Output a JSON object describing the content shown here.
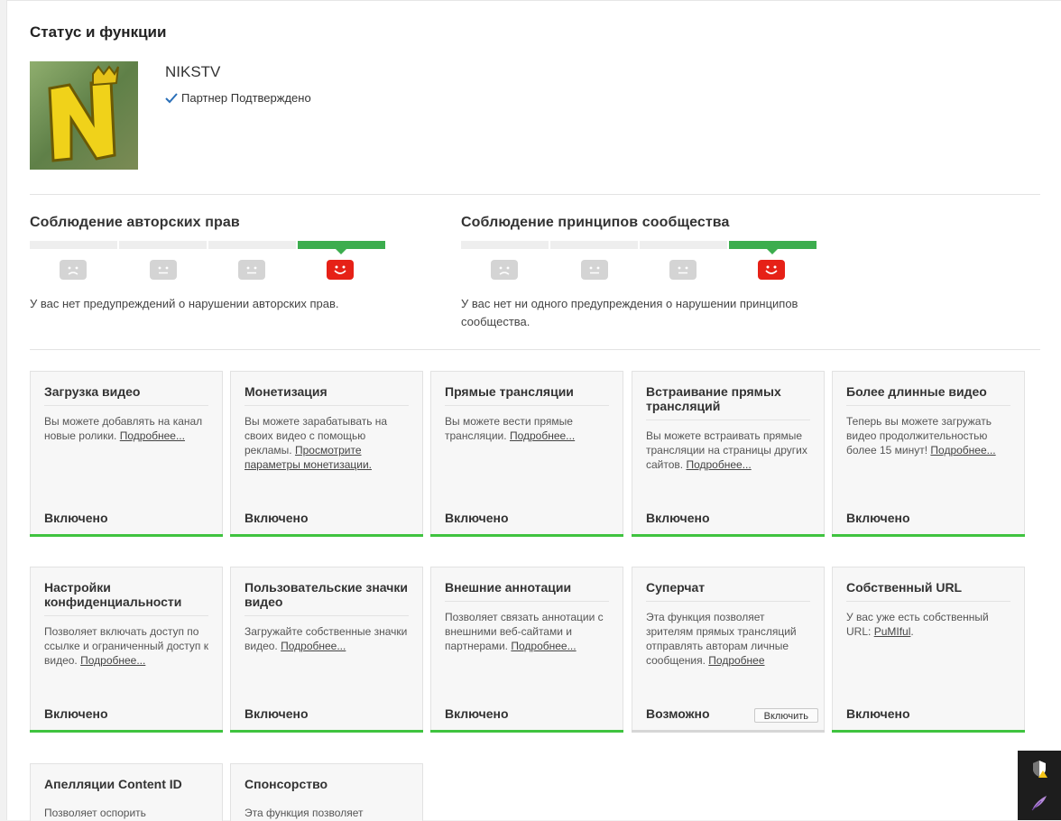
{
  "page": {
    "title": "Статус и функции"
  },
  "channel": {
    "name": "NIKSTV",
    "status": "Партнер Подтверждено"
  },
  "copyright": {
    "title": "Соблюдение авторских прав",
    "message": "У вас нет предупреждений о нарушении авторских прав."
  },
  "community": {
    "title": "Соблюдение принципов сообщества",
    "message": "У вас нет ни одного предупреждения о нарушении принципов сообщества."
  },
  "cards": [
    {
      "title": "Загрузка видео",
      "desc": "Вы можете добавлять на канал новые ролики.",
      "link": "Подробнее...",
      "status": "Включено"
    },
    {
      "title": "Монетизация",
      "desc": "Вы можете зарабатывать на своих видео с помощью рекламы.",
      "link": "Просмотрите параметры монетизации.",
      "status": "Включено"
    },
    {
      "title": "Прямые трансляции",
      "desc": "Вы можете вести прямые трансляции.",
      "link": "Подробнее...",
      "status": "Включено"
    },
    {
      "title": "Встраивание прямых трансляций",
      "desc": "Вы можете встраивать прямые трансляции на страницы других сайтов.",
      "link": "Подробнее...",
      "status": "Включено"
    },
    {
      "title": "Более длинные видео",
      "desc": "Теперь вы можете загружать видео продолжительностью более 15 минут!",
      "link": "Подробнее...",
      "status": "Включено"
    },
    {
      "title": "Настройки конфиденциальности",
      "desc": "Позволяет включать доступ по ссылке и ограниченный доступ к видео.",
      "link": "Подробнее...",
      "status": "Включено"
    },
    {
      "title": "Пользовательские значки видео",
      "desc": "Загружайте собственные значки видео.",
      "link": "Подробнее...",
      "status": "Включено"
    },
    {
      "title": "Внешние аннотации",
      "desc": "Позволяет связать аннотации с внешними веб-сайтами и партнерами.",
      "link": "Подробнее...",
      "status": "Включено"
    },
    {
      "title": "Суперчат",
      "desc": "Эта функция позволяет зрителям прямых трансляций отправлять авторам личные сообщения.",
      "link": "Подробнее",
      "status": "Возможно",
      "button": "Включить"
    },
    {
      "title": "Собственный URL",
      "desc": "У вас уже есть собственный URL:",
      "link": "PuMIful",
      "status": "Включено"
    },
    {
      "title": "Апелляции Content ID",
      "desc": "Позволяет оспорить"
    },
    {
      "title": "Спонсорство",
      "desc": "Эта функция позволяет"
    }
  ],
  "colors": {
    "enabled": "#3fc33f",
    "good_standing": "#3cad4e",
    "strike_face_active": "#e62117"
  }
}
